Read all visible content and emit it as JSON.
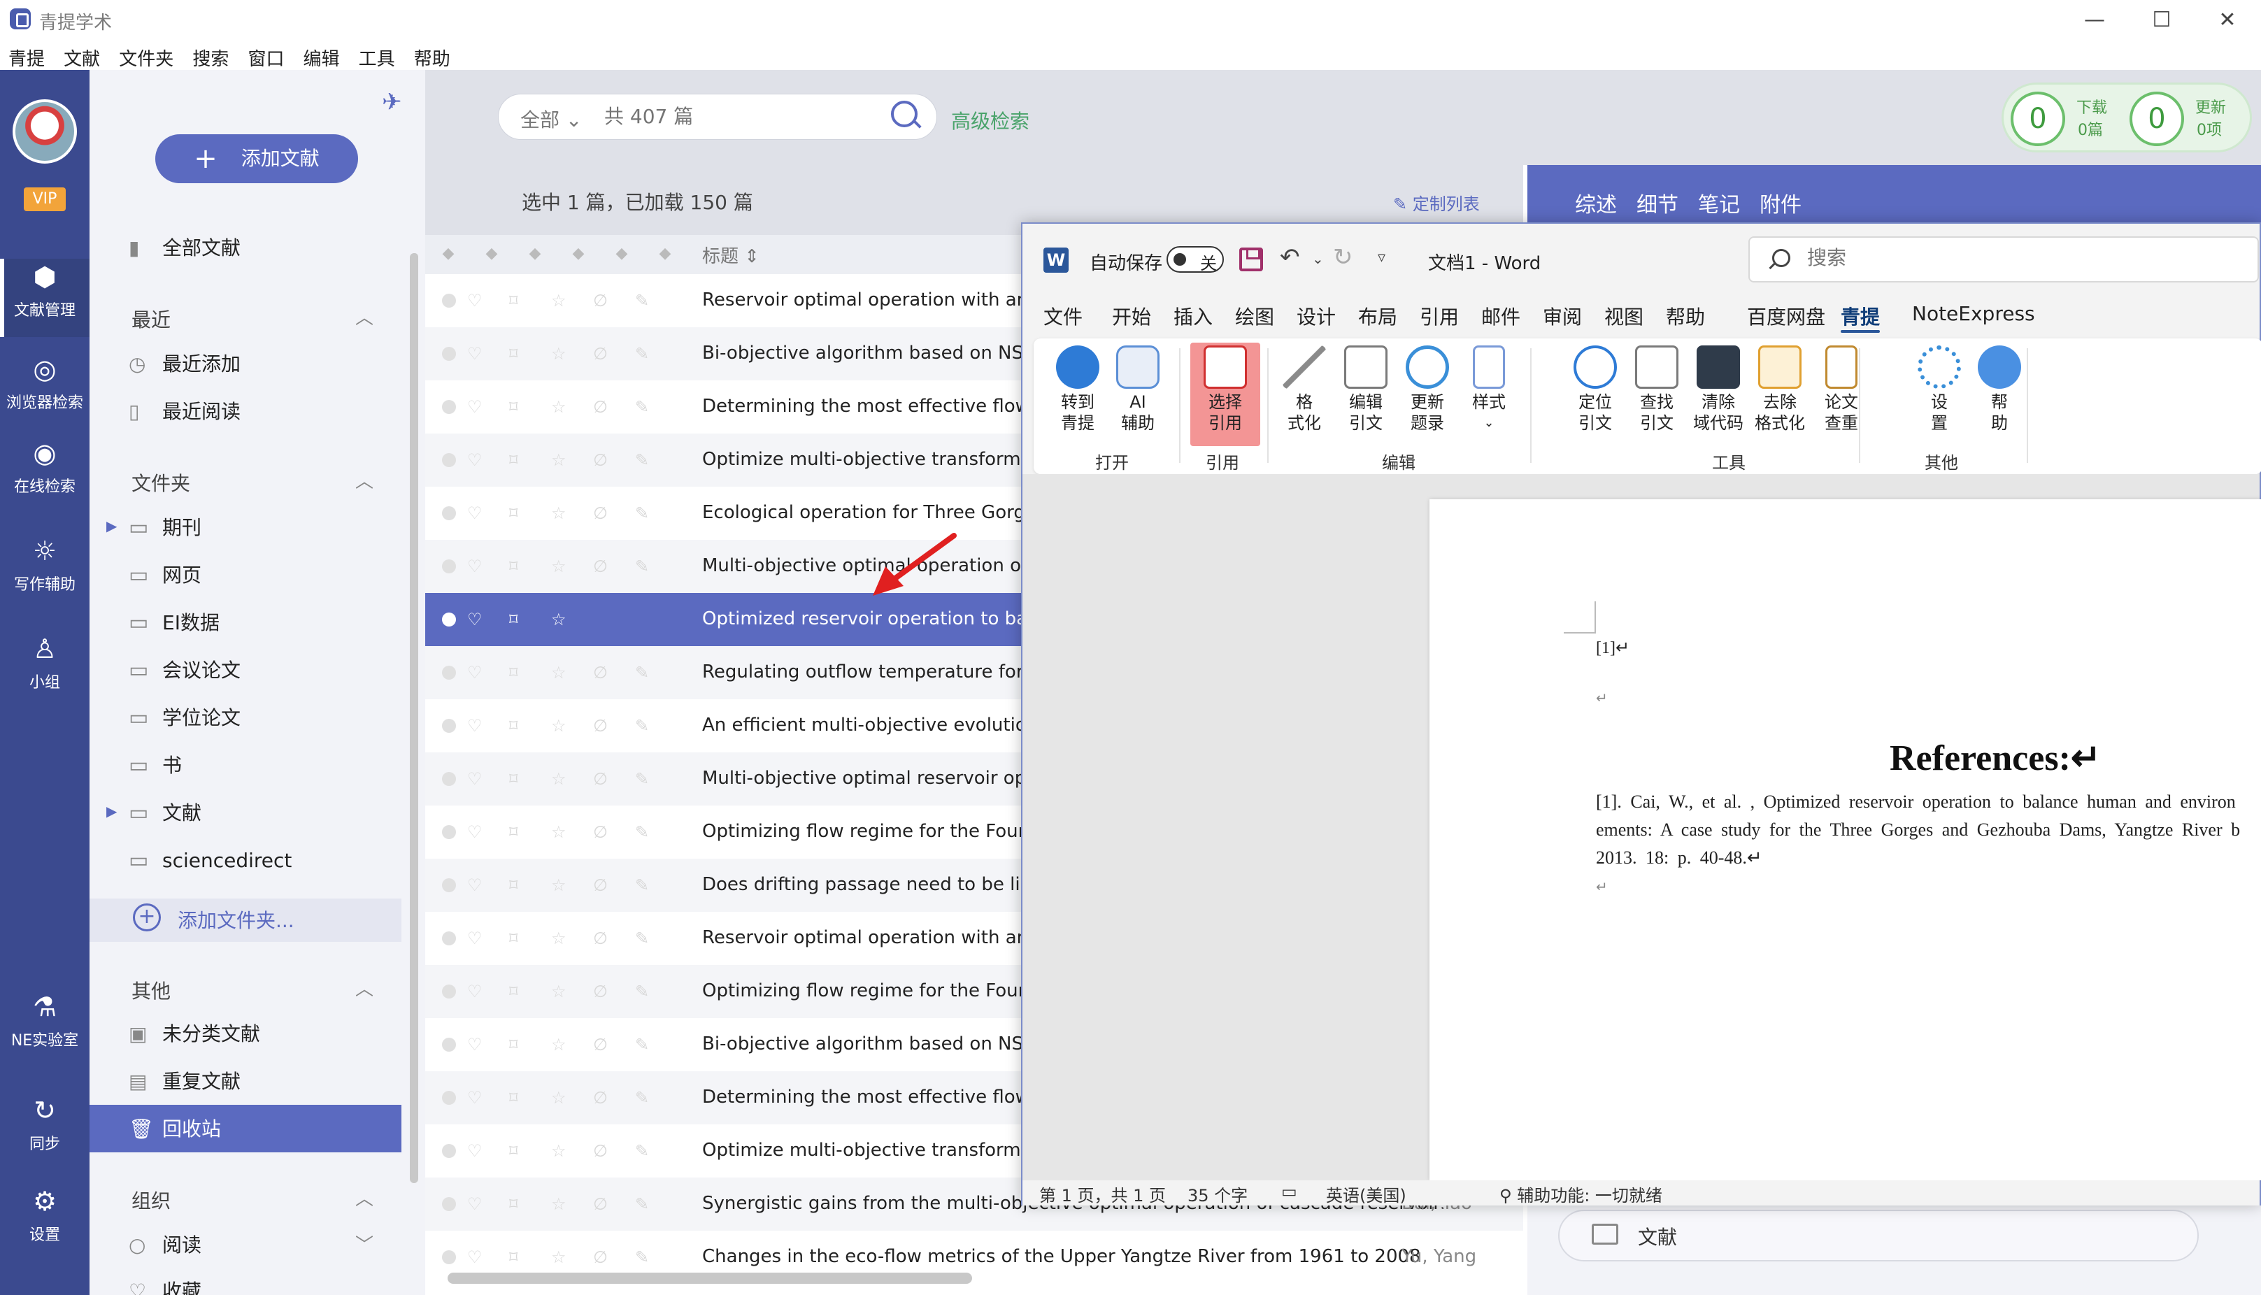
{
  "window": {
    "app_title": "青提学术",
    "minimize": "—",
    "maximize": "☐",
    "close": "✕"
  },
  "menubar": [
    "青提",
    "文献",
    "文件夹",
    "搜索",
    "窗口",
    "编辑",
    "工具",
    "帮助"
  ],
  "leftnav": {
    "vip": "VIP",
    "items": [
      {
        "label": "文献管理",
        "icon": "cube-icon"
      },
      {
        "label": "浏览器检索",
        "icon": "browser-icon"
      },
      {
        "label": "在线检索",
        "icon": "eye-icon"
      },
      {
        "label": "写作辅助",
        "icon": "bulb-icon"
      },
      {
        "label": "小组",
        "icon": "group-icon"
      },
      {
        "label": "NE实验室",
        "icon": "flask-icon"
      },
      {
        "label": "同步",
        "icon": "sync-icon"
      },
      {
        "label": "设置",
        "icon": "gear-icon"
      }
    ]
  },
  "sidebar": {
    "add_doc": "添加文献",
    "all_docs": "全部文献",
    "recent": {
      "title": "最近",
      "items": [
        "最近添加",
        "最近阅读"
      ]
    },
    "folders": {
      "title": "文件夹",
      "items": [
        "期刊",
        "网页",
        "EI数据",
        "会议论文",
        "学位论文",
        "书",
        "文献",
        "sciencedirect"
      ],
      "add_folder": "添加文件夹..."
    },
    "other": {
      "title": "其他",
      "items": [
        "未分类文献",
        "重复文献",
        "回收站"
      ]
    },
    "org": {
      "title": "组织",
      "items": [
        "阅读",
        "收藏"
      ]
    }
  },
  "search": {
    "scope": "全部",
    "placeholder": "共 407 篇",
    "advanced": "高级检索"
  },
  "counters": {
    "download": {
      "value": "0",
      "label": "下载",
      "sub": "0篇"
    },
    "update": {
      "value": "0",
      "label": "更新",
      "sub": "0项"
    }
  },
  "list": {
    "selection_info": "选中 1 篇，已加载 150 篇",
    "customize": "定制列表",
    "column_title": "标题",
    "rows": [
      {
        "title": "Reservoir optimal operation with an inte",
        "author": ""
      },
      {
        "title": "Bi-objective algorithm based on NSGA-",
        "author": ""
      },
      {
        "title": "Determining the most effective flow risi",
        "author": ""
      },
      {
        "title": "Optimize multi-objective transformation",
        "author": ""
      },
      {
        "title": "Ecological operation for Three Gorges R",
        "author": ""
      },
      {
        "title": "Multi-objective optimal operation of a l",
        "author": ""
      },
      {
        "title": "Optimized reservoir operation to balanc",
        "author": ""
      },
      {
        "title": "Regulating outflow temperature for mul",
        "author": ""
      },
      {
        "title": "An efficient multi-objective evolutionary",
        "author": ""
      },
      {
        "title": "Multi-objective optimal reservoir operat",
        "author": ""
      },
      {
        "title": "Optimizing flow regime for the Four Ma",
        "author": ""
      },
      {
        "title": "Does drifting passage need to be linked",
        "author": ""
      },
      {
        "title": "Reservoir optimal operation with an inte",
        "author": ""
      },
      {
        "title": "Optimizing flow regime for the Four Ma",
        "author": ""
      },
      {
        "title": "Bi-objective algorithm based on NSGA-",
        "author": ""
      },
      {
        "title": "Determining the most effective flow risi",
        "author": ""
      },
      {
        "title": "Optimize multi-objective transformation",
        "author": ""
      },
      {
        "title": "Synergistic gains from the multi-objective optimal operation of cascade reservoirs in",
        "author": "Bai, Tao"
      },
      {
        "title": "Changes in the eco-flow metrics of the Upper Yangtze River from 1961 to 2008",
        "author": "Yu, Yang"
      }
    ]
  },
  "detail": {
    "tabs": [
      "综述",
      "细节",
      "笔记",
      "附件"
    ],
    "folder_label": "文献"
  },
  "word": {
    "autosave": "自动保存",
    "autosave_state": "关",
    "doc_title": "文档1  -  Word",
    "search_placeholder": "搜索",
    "menu": [
      "文件",
      "开始",
      "插入",
      "绘图",
      "设计",
      "布局",
      "引用",
      "邮件",
      "审阅",
      "视图",
      "帮助",
      "百度网盘",
      "青提",
      "NoteExpress"
    ],
    "ribbon": {
      "buttons": [
        {
          "l1": "转到",
          "l2": "青提"
        },
        {
          "l1": "AI",
          "l2": "辅助"
        },
        {
          "l1": "选择",
          "l2": "引用"
        },
        {
          "l1": "格",
          "l2": "式化"
        },
        {
          "l1": "编辑",
          "l2": "引文"
        },
        {
          "l1": "更新",
          "l2": "题录"
        },
        {
          "l1": "样式",
          "l2": "⌄"
        },
        {
          "l1": "定位",
          "l2": "引文"
        },
        {
          "l1": "查找",
          "l2": "引文"
        },
        {
          "l1": "清除",
          "l2": "域代码"
        },
        {
          "l1": "去除",
          "l2": "格式化"
        },
        {
          "l1": "论文",
          "l2": "查重"
        },
        {
          "l1": "设",
          "l2": "置"
        },
        {
          "l1": "帮",
          "l2": "助"
        }
      ],
      "groups": [
        "打开",
        "引用",
        "编辑",
        "工具",
        "其他"
      ]
    },
    "document": {
      "cite_mark": "[1]↵",
      "para": "↵",
      "heading": "References:↵",
      "ref_lines": [
        "[1].  Cai,  W.,  et al. ,  Optimized  reservoir  operation  to  balance  human  and  environ",
        "ements:  A  case  study  for  the  Three  Gorges  and  Gezhouba  Dams,  Yangtze  River  b",
        "2013.  18:  p.  40-48.↵"
      ]
    },
    "status": {
      "page": "第 1 页，共 1 页",
      "words": "35 个字",
      "lang": "英语(美国)",
      "accessibility": "辅助功能: 一切就绪"
    }
  }
}
